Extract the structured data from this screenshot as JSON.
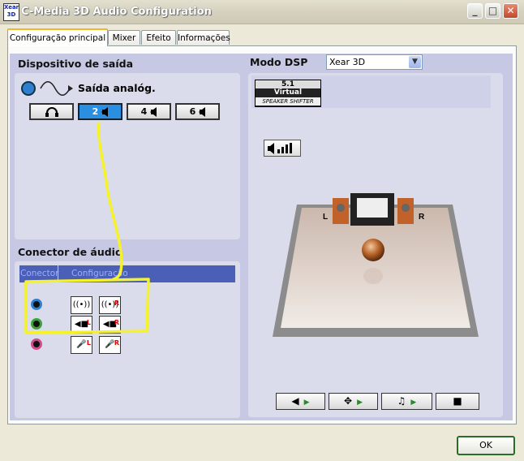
{
  "window": {
    "title": "C-Media 3D Audio Configuration",
    "icon_text": "Xear 3D"
  },
  "tabs": [
    {
      "label": "Configuração principal"
    },
    {
      "label": "Mixer"
    },
    {
      "label": "Efeito"
    },
    {
      "label": "Informações"
    }
  ],
  "output": {
    "title": "Dispositivo de saída",
    "device_label": "Saída analóg.",
    "modes": [
      {
        "label": "",
        "icon": "headphones-icon"
      },
      {
        "label": "2",
        "icon": "speaker-icon",
        "selected": true
      },
      {
        "label": "4",
        "icon": "speaker-icon"
      },
      {
        "label": "6",
        "icon": "speaker-icon"
      }
    ]
  },
  "connector": {
    "title": "Conector de áudio",
    "col_connector": "Conector",
    "col_config": "Configuração",
    "rows": [
      {
        "jack_color": "#2f7fd0",
        "buttons": [
          "",
          "R"
        ]
      },
      {
        "jack_color": "#3aa33a",
        "buttons": [
          "L",
          "R"
        ]
      },
      {
        "jack_color": "#d04b8a",
        "buttons": [
          "L",
          "R"
        ]
      }
    ]
  },
  "dsp": {
    "title": "Modo DSP",
    "selected": "Xear 3D",
    "badge_top": "5.1",
    "badge_mid": "Virtual",
    "badge_bottom": "SPEAKER SHIFTER",
    "speaker_left": "L",
    "speaker_right": "R"
  },
  "ok_label": "OK"
}
